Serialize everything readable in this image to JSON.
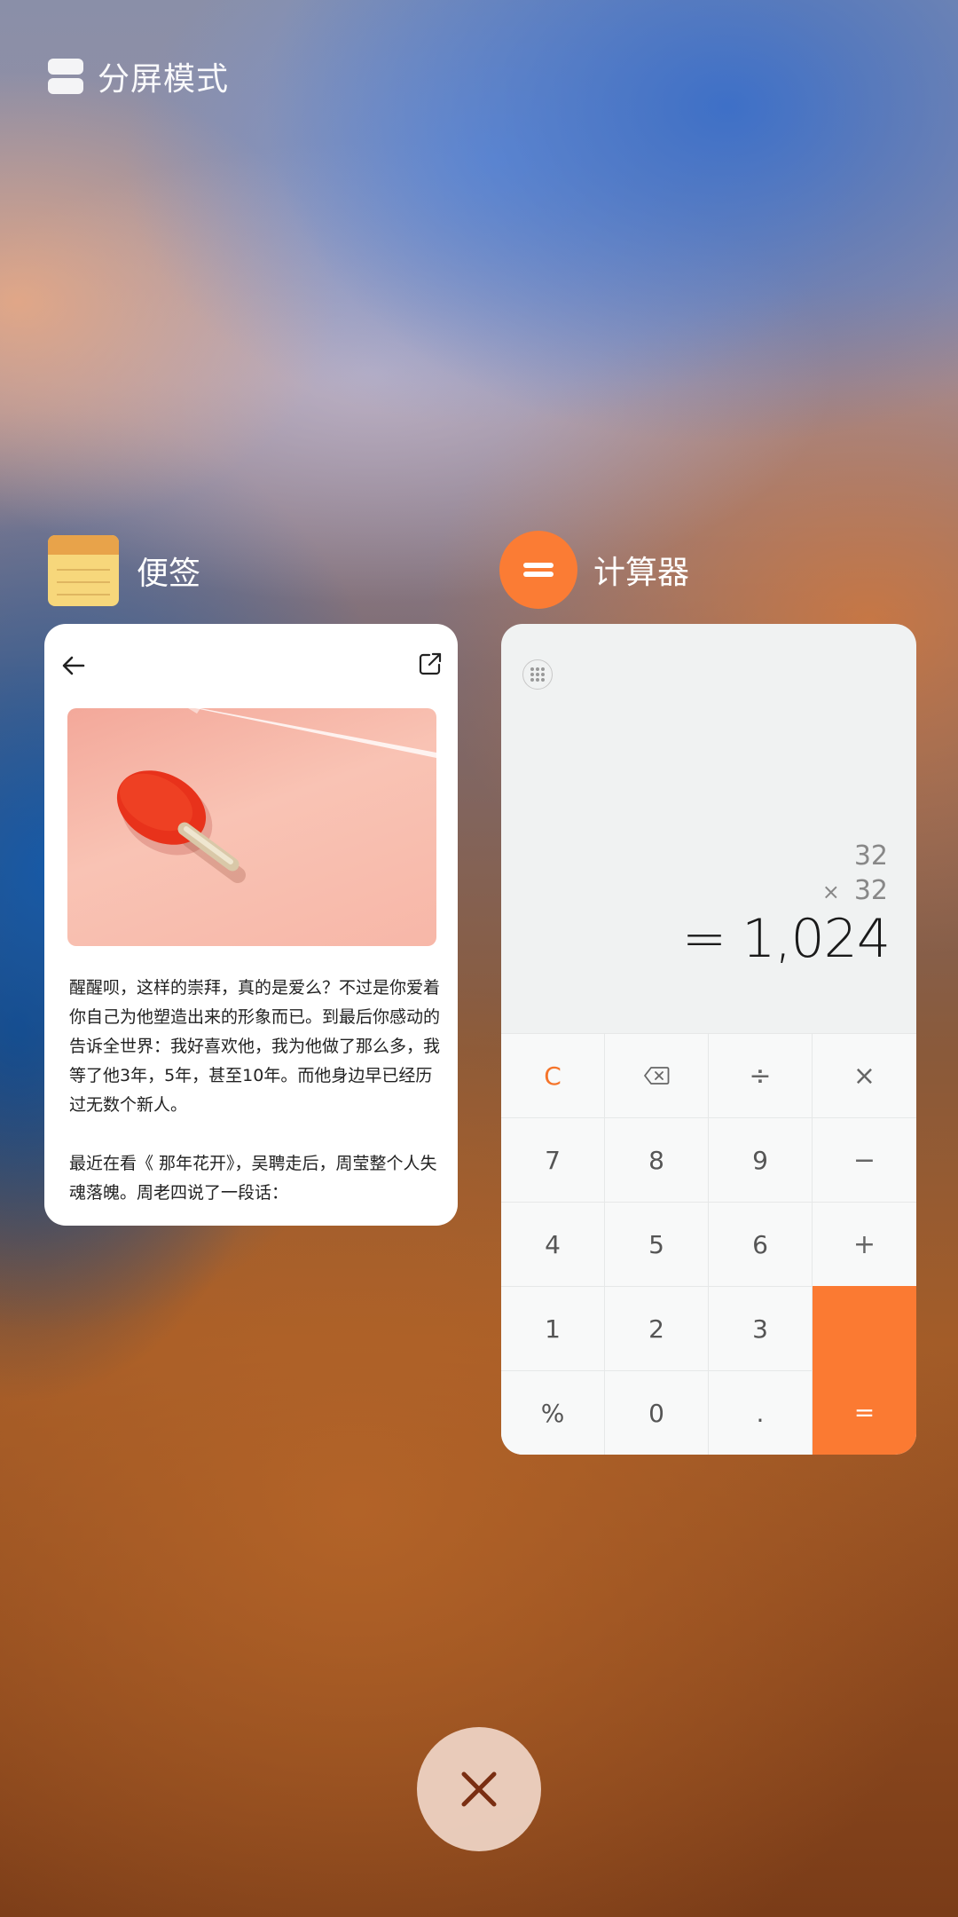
{
  "header": {
    "label": "分屏模式",
    "icon": "split-screen-icon"
  },
  "apps": {
    "notes": {
      "label": "便签",
      "icon": "notes-app-icon",
      "icon_color": "#f7d77b"
    },
    "calculator": {
      "label": "计算器",
      "icon": "calculator-app-icon",
      "icon_color": "#fb7c34"
    }
  },
  "note": {
    "paragraph1": "醒醒呗，这样的崇拜，真的是爱么？不过是你爱着你自己为他塑造出来的形象而已。到最后你感动的告诉全世界：我好喜欢他，我为他做了那么多，我等了他3年，5年，甚至10年。而他身边早已经历过无数个新人。",
    "paragraph2": "最近在看《 那年花开》，吴聘走后，周莹整个人失魂落魄。周老四说了一段话："
  },
  "calculator": {
    "operand1": "32",
    "operator": "×",
    "operand2": "32",
    "result": "= 1,024",
    "accent": "#fb7a32",
    "keys": [
      "C",
      "⌫",
      "÷",
      "×",
      "7",
      "8",
      "9",
      "−",
      "4",
      "5",
      "6",
      "+",
      "1",
      "2",
      "3",
      "",
      "%",
      "0",
      ".",
      "="
    ]
  },
  "close_button": {
    "icon": "close-icon"
  }
}
